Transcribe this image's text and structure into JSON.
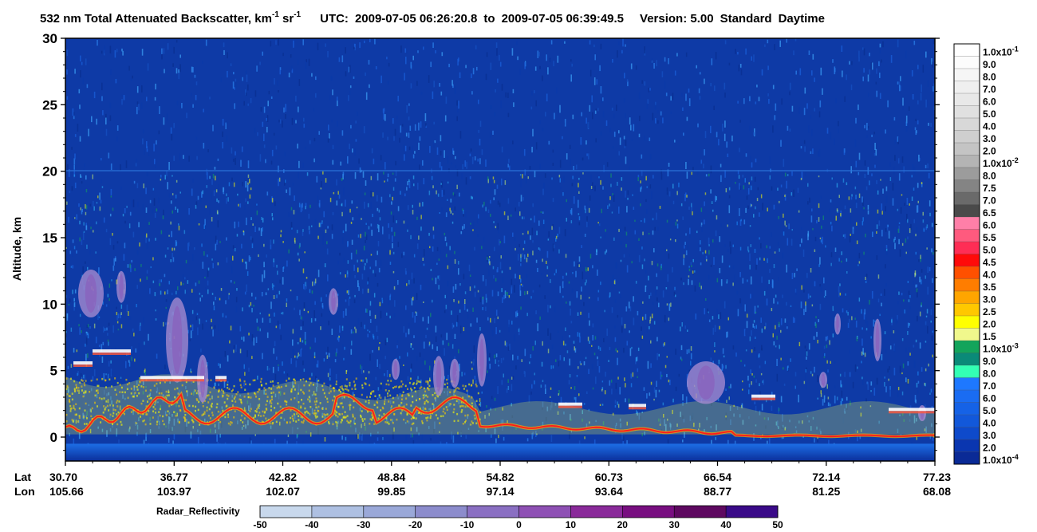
{
  "chart_data": {
    "type": "heatmap",
    "title": {
      "main": "532 nm Total Attenuated Backscatter, km",
      "sup1": "-1",
      "sr": " sr",
      "sup2": "-1",
      "utc_label": "UTC:",
      "utc_start": "2009-07-05 06:26:20.8",
      "to": "to",
      "utc_end": "2009-07-05 06:39:49.5",
      "version": "Version: 5.00",
      "product": "Standard",
      "mode": "Daytime"
    },
    "ylabel": "Altitude, km",
    "ylim": [
      -1.8,
      30
    ],
    "y_major_ticks": [
      "0",
      "5",
      "10",
      "15",
      "20",
      "25",
      "30"
    ],
    "x_row_labels": [
      "Lat",
      "Lon"
    ],
    "x_ticks": [
      {
        "lat": "30.70",
        "lon": "105.66"
      },
      {
        "lat": "36.77",
        "lon": "103.97"
      },
      {
        "lat": "42.82",
        "lon": "102.07"
      },
      {
        "lat": "48.84",
        "lon": "99.85"
      },
      {
        "lat": "54.82",
        "lon": "97.14"
      },
      {
        "lat": "60.73",
        "lon": "93.64"
      },
      {
        "lat": "66.54",
        "lon": "88.77"
      },
      {
        "lat": "72.14",
        "lon": "81.25"
      },
      {
        "lat": "77.23",
        "lon": "68.08"
      }
    ],
    "colorbar": [
      {
        "label": "1.0x10",
        "exp": "-1",
        "color": "#ffffff"
      },
      {
        "label": "9.0",
        "color": "#fcfcfc"
      },
      {
        "label": "8.0",
        "color": "#f6f6f6"
      },
      {
        "label": "7.0",
        "color": "#efefef"
      },
      {
        "label": "6.0",
        "color": "#e8e8e8"
      },
      {
        "label": "5.0",
        "color": "#e0e0e0"
      },
      {
        "label": "4.0",
        "color": "#d8d8d8"
      },
      {
        "label": "3.0",
        "color": "#cfcfcf"
      },
      {
        "label": "2.0",
        "color": "#c4c4c4"
      },
      {
        "label": "1.0x10",
        "exp": "-2",
        "color": "#b4b4b4"
      },
      {
        "label": "8.0",
        "color": "#9c9c9c"
      },
      {
        "label": "7.5",
        "color": "#848484"
      },
      {
        "label": "7.0",
        "color": "#6a6a6a"
      },
      {
        "label": "6.5",
        "color": "#4a4a4a"
      },
      {
        "label": "6.0",
        "color": "#ff7fa8"
      },
      {
        "label": "5.5",
        "color": "#ff5a7e"
      },
      {
        "label": "5.0",
        "color": "#ff2d55"
      },
      {
        "label": "4.5",
        "color": "#ff0a0a"
      },
      {
        "label": "4.0",
        "color": "#ff5000"
      },
      {
        "label": "3.5",
        "color": "#ff7d00"
      },
      {
        "label": "3.0",
        "color": "#ffa500"
      },
      {
        "label": "2.5",
        "color": "#ffc800"
      },
      {
        "label": "2.0",
        "color": "#ffff00"
      },
      {
        "label": "1.5",
        "color": "#f0f88c"
      },
      {
        "label": "1.0x10",
        "exp": "-3",
        "color": "#13a45b"
      },
      {
        "label": "9.0",
        "color": "#0a8a78"
      },
      {
        "label": "8.0",
        "color": "#33ffb4"
      },
      {
        "label": "7.0",
        "color": "#1e78ff"
      },
      {
        "label": "6.0",
        "color": "#1a6cf2"
      },
      {
        "label": "5.0",
        "color": "#1562e6"
      },
      {
        "label": "4.0",
        "color": "#1258da"
      },
      {
        "label": "3.0",
        "color": "#0e4acb"
      },
      {
        "label": "2.0",
        "color": "#0a36b0"
      },
      {
        "label": "1.0x10",
        "exp": "-4",
        "color": "#0a2a96"
      }
    ],
    "radar_reflectivity": {
      "label": "Radar_Reflectivity",
      "ticks": [
        "-50",
        "-40",
        "-30",
        "-20",
        "-10",
        "0",
        "10",
        "20",
        "30",
        "40",
        "50"
      ],
      "colors": [
        "#c8d8ec",
        "#aec0e2",
        "#9aa8d8",
        "#8c8ccc",
        "#8a6fc2",
        "#8e50b4",
        "#8a2a9a",
        "#780e80",
        "#5e0860",
        "#3a0a88"
      ]
    }
  }
}
